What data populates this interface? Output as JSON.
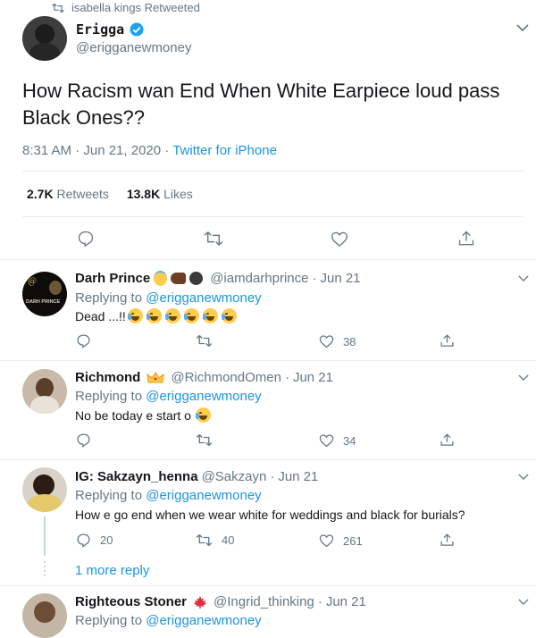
{
  "retweet_header": {
    "text": "isabella kings Retweeted"
  },
  "main_tweet": {
    "author_name": "Erigga",
    "handle": "@erigganewmoney",
    "text": "How Racism wan End When White Earpiece loud pass Black Ones??",
    "time": "8:31 AM · Jun 21, 2020",
    "source": "Twitter for iPhone",
    "retweets_count": "2.7K",
    "retweets_label": "Retweets",
    "likes_count": "13.8K",
    "likes_label": "Likes"
  },
  "replies": [
    {
      "name": "Darh Prince",
      "handle": "@iamdarhprince",
      "date": "Jun 21",
      "replying_prefix": "Replying to",
      "replying_to": "@erigganewmoney",
      "text": "Dead ...!!",
      "reply_count": "",
      "retweet_count": "",
      "like_count": "38",
      "avatar_text": "DARH PRINCE"
    },
    {
      "name": "Richmond",
      "handle": "@RichmondOmen",
      "date": "Jun 21",
      "replying_prefix": "Replying to",
      "replying_to": "@erigganewmoney",
      "text": "No be today e start o",
      "reply_count": "",
      "retweet_count": "",
      "like_count": "34"
    },
    {
      "name": "IG: Sakzayn_henna",
      "handle": "@Sakzayn",
      "date": "Jun 21",
      "replying_prefix": "Replying to",
      "replying_to": "@erigganewmoney",
      "text": "How e go end when we wear white for weddings and black for burials?",
      "reply_count": "20",
      "retweet_count": "40",
      "like_count": "261"
    },
    {
      "name": "Righteous Stoner",
      "handle": "@Ingrid_thinking",
      "date": "Jun 21",
      "replying_prefix": "Replying to",
      "replying_to": "@erigganewmoney"
    }
  ],
  "more_replies": "1 more reply",
  "colors": {
    "accent": "#1b95e0",
    "muted": "#657786",
    "verified": "#1da1f2",
    "separator": "#e6ecf0"
  },
  "icons": [
    "retweet-icon",
    "verified-badge-icon",
    "chevron-down-icon",
    "reply-icon",
    "heart-icon",
    "share-icon",
    "crown-icon",
    "muscle-emoji-icon",
    "gorilla-emoji-icon",
    "tears-of-joy-emoji-icon",
    "canada-flag-icon"
  ]
}
